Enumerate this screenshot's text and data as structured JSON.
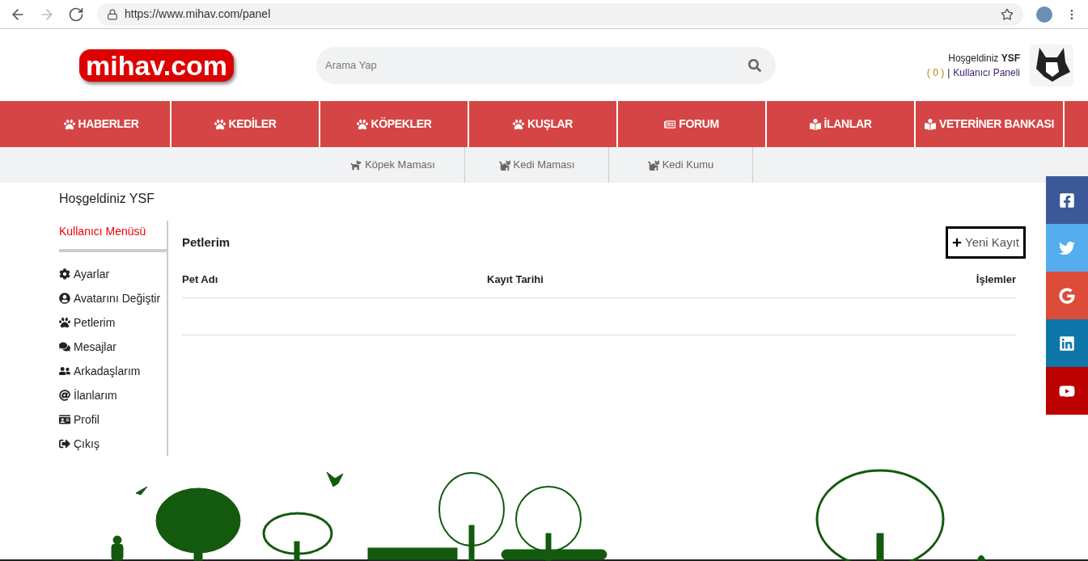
{
  "browser": {
    "url": "https://www.mihav.com/panel"
  },
  "header": {
    "logo": "mihav.com",
    "search": {
      "placeholder": "Arama Yap"
    },
    "greeting": "Hoşgeldiniz **YSF**",
    "count": "( 0 )",
    "separator": "|",
    "panel_link": "Kullanıcı Paneli"
  },
  "nav": [
    {
      "label": "HABERLER",
      "kind": "paw"
    },
    {
      "label": "KEDİLER",
      "kind": "paw"
    },
    {
      "label": "KÖPEKLER",
      "kind": "paw"
    },
    {
      "label": "KUŞLAR",
      "kind": "paw"
    },
    {
      "label": "FORUM",
      "kind": "newspaper"
    },
    {
      "label": "İLANLAR",
      "kind": "reader"
    },
    {
      "label": "VETERİNER BANKASI",
      "kind": "reader"
    }
  ],
  "subnav": [
    {
      "label": "Köpek Maması",
      "kind": "dog"
    },
    {
      "label": "Kedi Maması",
      "kind": "cat"
    },
    {
      "label": "Kedi Kumu",
      "kind": "cat"
    }
  ],
  "page_title": "Hoşgeldiniz YSF",
  "sidebar": {
    "title": "Kullanıcı Menüsü",
    "items": [
      {
        "label": "Ayarlar",
        "kind": "gear"
      },
      {
        "label": "Avatarını Değiştir",
        "kind": "user"
      },
      {
        "label": "Petlerim",
        "kind": "paw"
      },
      {
        "label": "Mesajlar",
        "kind": "comments"
      },
      {
        "label": "Arkadaşlarım",
        "kind": "friends"
      },
      {
        "label": "İlanlarım",
        "kind": "at"
      },
      {
        "label": "Profil",
        "kind": "card"
      },
      {
        "label": "Çıkış",
        "kind": "exit"
      }
    ]
  },
  "panel": {
    "title": "Petlerim",
    "new_button": "Yeni Kayıt",
    "columns": [
      "Pet Adı",
      "Kayıt Tarihi",
      "İşlemler"
    ]
  },
  "social": [
    {
      "kind": "facebook"
    },
    {
      "kind": "twitter"
    },
    {
      "kind": "google"
    },
    {
      "kind": "linkedin"
    },
    {
      "kind": "youtube"
    }
  ]
}
